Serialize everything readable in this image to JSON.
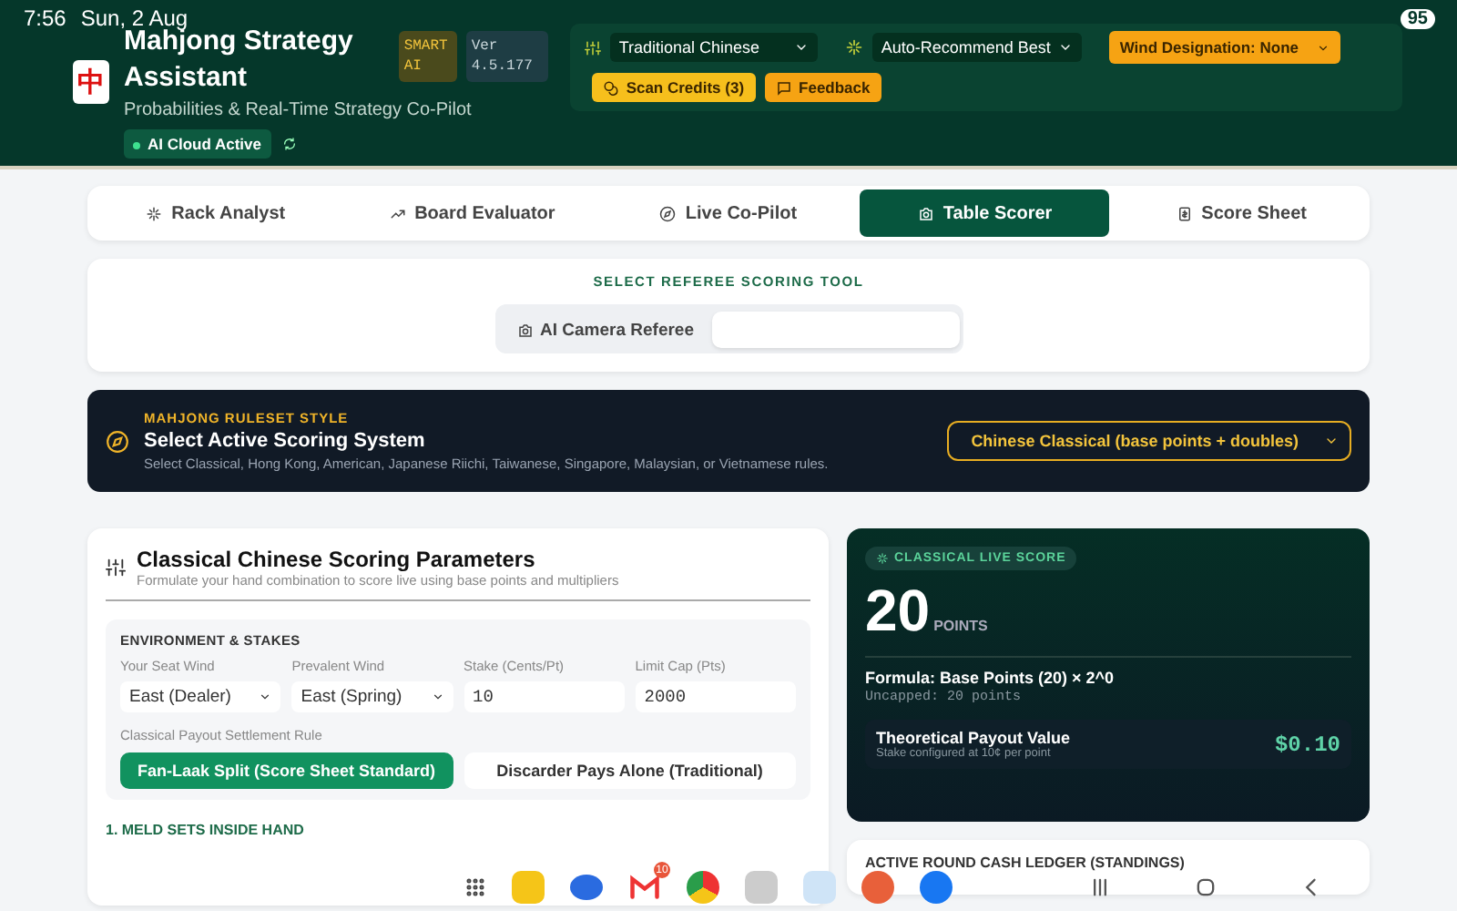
{
  "status_bar": {
    "time": "7:56",
    "date": "Sun, 2 Aug",
    "battery": "95"
  },
  "header": {
    "logo": "中",
    "title": "Mahjong Strategy Assistant",
    "subtitle": "Probabilities & Real-Time Strategy Co-Pilot",
    "status_badge": "AI Cloud Active",
    "smart_badge": "SMART AI",
    "version_badge": "Ver 4.5.177",
    "language_select": "Traditional Chinese",
    "strategy_select": "Auto-Recommend Best",
    "wind_select": "Wind Designation: None",
    "scan_button": "Scan Credits (3)",
    "feedback_button": "Feedback"
  },
  "tabs": [
    {
      "label": "Rack Analyst",
      "selected": false
    },
    {
      "label": "Board Evaluator",
      "selected": false
    },
    {
      "label": "Live Co-Pilot",
      "selected": false
    },
    {
      "label": "Table Scorer",
      "selected": true
    },
    {
      "label": "Score Sheet",
      "selected": false
    }
  ],
  "referee_tool": {
    "title": "SELECT REFEREE SCORING TOOL",
    "options": [
      {
        "label": "AI Camera Referee",
        "selected": false
      },
      {
        "selected": true
      }
    ]
  },
  "ruleset": {
    "eyebrow": "MAHJONG RULESET STYLE",
    "title": "Select Active Scoring System",
    "description": "Select Classical, Hong Kong, American, Japanese Riichi, Taiwanese, Singapore, Malaysian, or Vietnamese rules.",
    "select": "Chinese Classical (base points + doubles)"
  },
  "parameters": {
    "title": "Classical Chinese Scoring Parameters",
    "subtitle": "Formulate your hand combination to score live using base points and multipliers",
    "section": "ENVIRONMENT & STAKES",
    "fields": [
      {
        "kind": "select",
        "label": "Your Seat Wind",
        "value": "East (Dealer)"
      },
      {
        "kind": "select",
        "label": "Prevalent Wind",
        "value": "East (Spring)"
      },
      {
        "kind": "input",
        "label": "Stake (Cents/Pt)",
        "value": "10"
      },
      {
        "kind": "input",
        "label": "Limit Cap (Pts)",
        "value": "2000"
      }
    ],
    "settlement_label": "Classical Payout Settlement Rule",
    "settlement_options": [
      {
        "label": "Fan-Laak Split (Score Sheet Standard)",
        "selected": true
      },
      {
        "label": "Discarder Pays Alone (Traditional)",
        "selected": false
      }
    ],
    "meld_heading": "1. MELD SETS INSIDE HAND"
  },
  "score": {
    "badge": "CLASSICAL LIVE SCORE",
    "points": "20",
    "unit": "POINTS",
    "formula": "Formula: Base Points (20) × 2^0",
    "uncapped": "Uncapped: 20 points",
    "payout_label": "Theoretical Payout Value",
    "payout_note": "Stake configured at 10¢ per point",
    "payout_value": "$0.10"
  },
  "ledger": {
    "title": "ACTIVE ROUND CASH LEDGER (STANDINGS)"
  },
  "dock": {
    "mail_badge": "10"
  }
}
